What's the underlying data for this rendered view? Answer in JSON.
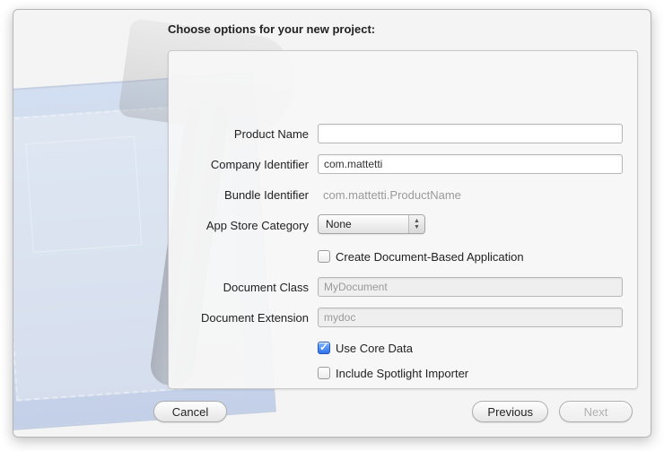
{
  "title": "Choose options for your new project:",
  "labels": {
    "product_name": "Product Name",
    "company_id": "Company Identifier",
    "bundle_id": "Bundle Identifier",
    "app_store": "App Store Category",
    "doc_class": "Document Class",
    "doc_ext": "Document Extension"
  },
  "values": {
    "product_name": "",
    "company_id": "com.mattetti",
    "bundle_id": "com.mattetti.ProductName",
    "app_store": "None",
    "doc_class": "MyDocument",
    "doc_ext": "mydoc"
  },
  "checkboxes": {
    "create_doc": {
      "label": "Create Document-Based Application",
      "checked": false
    },
    "core_data": {
      "label": "Use Core Data",
      "checked": true
    },
    "spotlight": {
      "label": "Include Spotlight Importer",
      "checked": false
    }
  },
  "buttons": {
    "cancel": "Cancel",
    "previous": "Previous",
    "next": "Next"
  }
}
